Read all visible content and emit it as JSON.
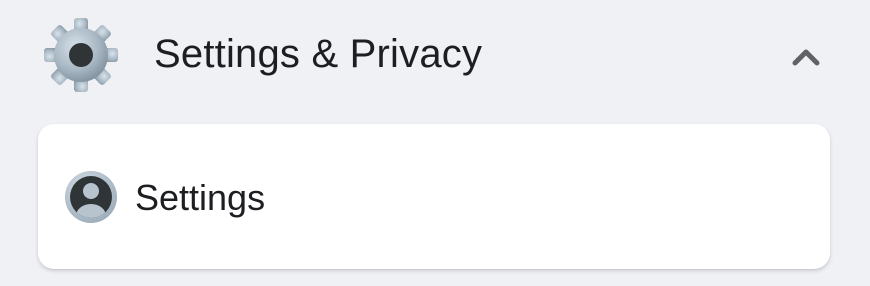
{
  "section": {
    "title": "Settings & Privacy",
    "icon": "gear-icon",
    "expanded": true,
    "toggle_icon": "chevron-up-icon"
  },
  "items": [
    {
      "label": "Settings",
      "icon": "user-avatar-icon"
    }
  ],
  "colors": {
    "background": "#f0f1f5",
    "card": "#ffffff",
    "text": "#1c1e21",
    "icon_gray": "#8e9aa4",
    "chevron": "#5f6368"
  }
}
